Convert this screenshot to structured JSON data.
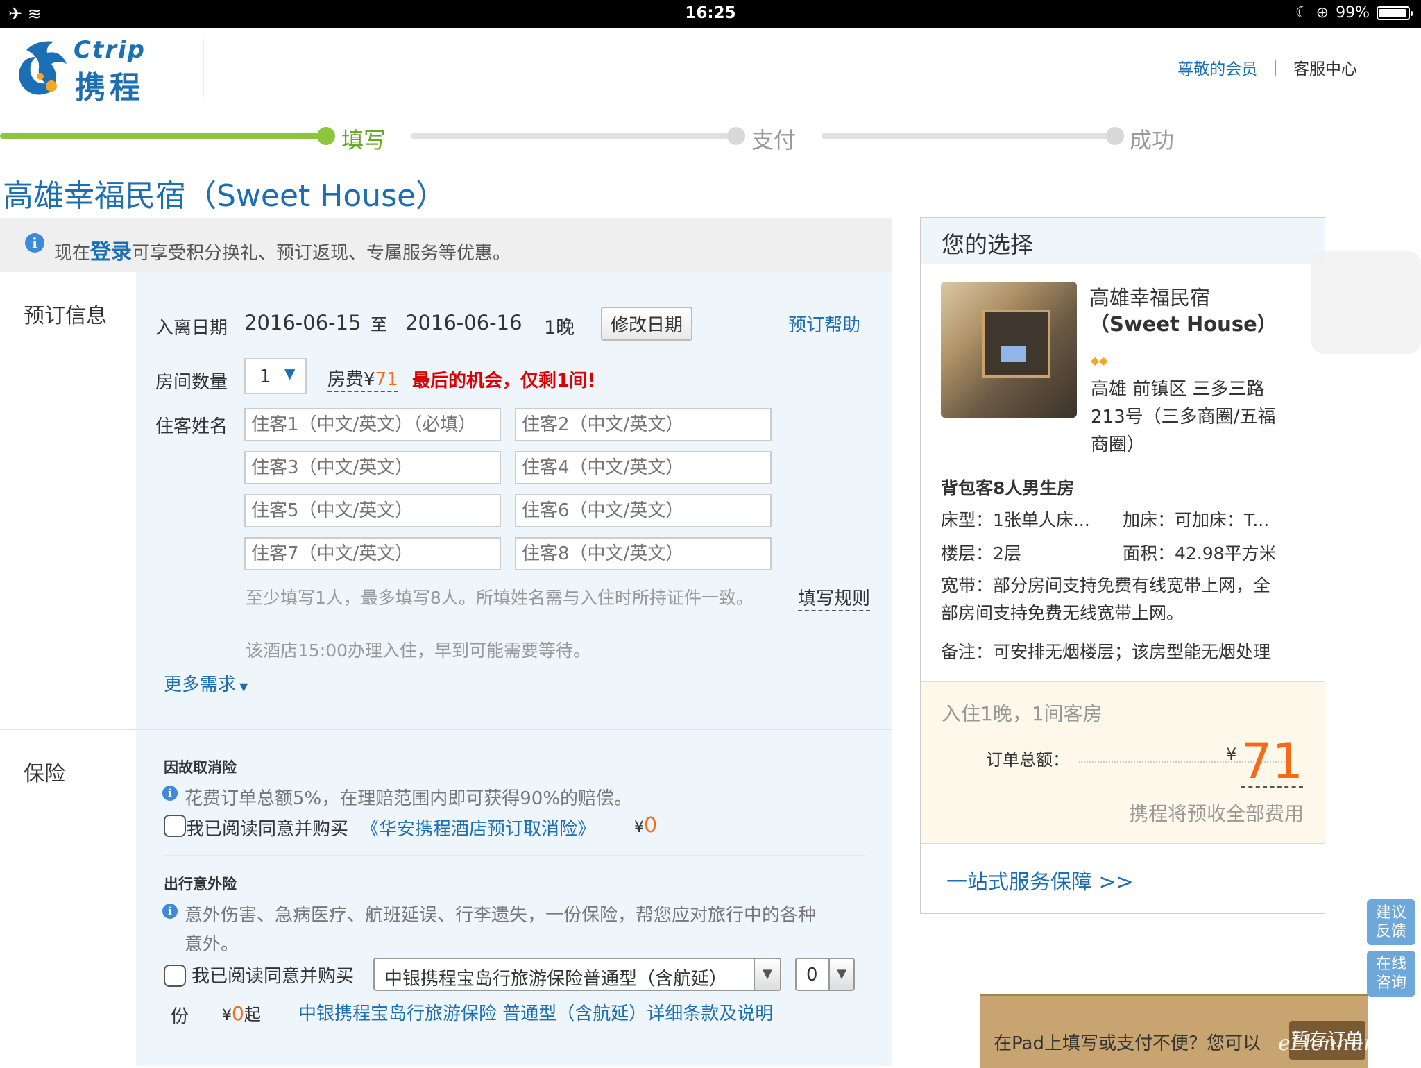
{
  "status_bar": {
    "time": "16:25",
    "battery": "99%"
  },
  "header": {
    "logo_en": "Ctrip",
    "logo_cn": "携程",
    "member_link": "尊敬的会员",
    "separator": "|",
    "service_link": "客服中心"
  },
  "progress": {
    "step1": "填写",
    "step2": "支付",
    "step3": "成功"
  },
  "hotel_title": "高雄幸福民宿（Sweet House）",
  "notice": {
    "prefix": "现在",
    "login": "登录",
    "suffix": "可享受积分换礼、预订返现、专属服务等优惠。"
  },
  "booking": {
    "section_label": "预订信息",
    "date_label": "入离日期",
    "checkin": "2016-06-15",
    "to": "至",
    "checkout": "2016-06-16",
    "nights": "1晚",
    "modify_btn": "修改日期",
    "help_link": "预订帮助",
    "room_qty_label": "房间数量",
    "room_qty": "1",
    "fee_label": "房费¥",
    "fee_value": "71",
    "last_chance": "最后的机会，仅剩1间！",
    "guest_label": "住客姓名",
    "guests": [
      "住客1（中文/英文）（必填）",
      "住客2（中文/英文）",
      "住客3（中文/英文）",
      "住客4（中文/英文）",
      "住客5（中文/英文）",
      "住客6（中文/英文）",
      "住客7（中文/英文）",
      "住客8（中文/英文）"
    ],
    "guest_hint": "至少填写1人，最多填写8人。所填姓名需与入住时所持证件一致。",
    "fill_rules": "填写规则",
    "checkin_hint": "该酒店15:00办理入住，早到可能需要等待。",
    "more_needs": "更多需求"
  },
  "insurance": {
    "section_label": "保险",
    "cancel_title": "因故取消险",
    "cancel_desc": "花费订单总额5%，在理赔范围内即可获得90%的赔偿。",
    "cancel_agree": "我已阅读同意并购买",
    "cancel_link": "《华安携程酒店预订取消险》",
    "cancel_price_symbol": "¥",
    "cancel_price": "0",
    "travel_title": "出行意外险",
    "travel_desc_1": "意外伤害、急病医疗、航班延误、行李遗失，一份保险，帮您应对旅行中的各种",
    "travel_desc_2": "意外。",
    "travel_agree": "我已阅读同意并购买",
    "travel_select": "中银携程宝岛行旅游保险普通型（含航延）",
    "travel_qty": "0",
    "unit": "份",
    "travel_price_symbol": "¥",
    "travel_price": "0",
    "travel_price_suffix": "起",
    "travel_link": "中银携程宝岛行旅游保险 普通型（含航延）详细条款及说明"
  },
  "selection": {
    "title": "您的选择",
    "hotel_name_1": "高雄幸福民宿",
    "hotel_name_2": "（Sweet House）",
    "address_1": "高雄 前镇区 三多三路",
    "address_2": "213号（三多商圈/五福",
    "address_3": "商圈）",
    "room_type": "背包客8人男生房",
    "bed_label": "床型：",
    "bed_value": "1张单人床...",
    "extra_label": "加床：",
    "extra_value": "可加床：T...",
    "floor_label": "楼层：",
    "floor_value": "2层",
    "area_label": "面积：",
    "area_value": "42.98平方米",
    "broadband_label": "宽带：",
    "broadband_value_1": "部分房间支持免费有线宽带上网，全",
    "broadband_value_2": "部房间支持免费无线宽带上网。",
    "remark_label": "备注：",
    "remark_value": "可安排无烟楼层；该房型能无烟处理",
    "stay_summary": "入住1晚，1间客房",
    "total_label": "订单总额：",
    "currency": "¥",
    "total": "71",
    "prepay_note": "携程将预收全部费用",
    "service_link": "一站式服务保障 >>"
  },
  "floating": {
    "feedback_1": "建议",
    "feedback_2": "反馈",
    "consult_1": "在线",
    "consult_2": "咨询"
  },
  "banner": {
    "text": "在Pad上填写或支付不便？您可以",
    "button": "暂存订单"
  },
  "watermark": "eLlenhung.net",
  "colors": {
    "accent_blue": "#1d6fb3",
    "progress_green": "#8cc63f",
    "price_orange": "#f76a16"
  }
}
